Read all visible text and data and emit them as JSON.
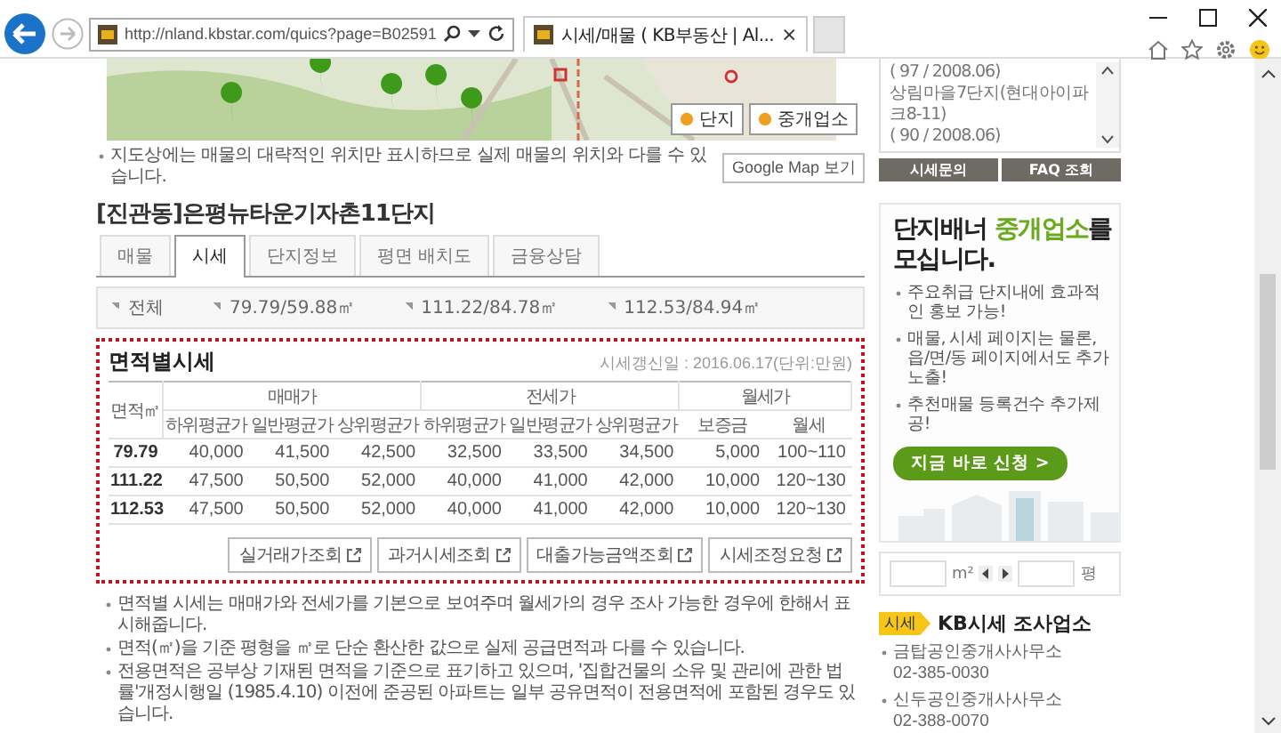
{
  "browser": {
    "url": "http://nland.kbstar.com/quics?page=B02591",
    "tab_title": "시세/매물 ( KB부동산 | Al...",
    "tab_close": "×"
  },
  "map": {
    "buttons": [
      {
        "label": "단지"
      },
      {
        "label": "중개업소"
      }
    ]
  },
  "map_notice": "지도상에는 매물의 대략적인 위치만 표시하므로 실제 매물의 위치와 다를 수 있습니다.",
  "map_button": "Google Map 보기",
  "complex_title": "[진관동]은평뉴타운기자촌11단지",
  "tabs": [
    {
      "label": "매물",
      "selected": false
    },
    {
      "label": "시세",
      "selected": true
    },
    {
      "label": "단지정보",
      "selected": false
    },
    {
      "label": "평면 배치도",
      "selected": false
    },
    {
      "label": "금융상담",
      "selected": false
    }
  ],
  "area_filters": [
    {
      "label": "전체"
    },
    {
      "label": "79.79/59.88㎡"
    },
    {
      "label": "111.22/84.78㎡"
    },
    {
      "label": "112.53/84.94㎡"
    }
  ],
  "price_table": {
    "title": "면적별시세",
    "update_note": "시세갱신일 : 2016.06.17(단위:만원)",
    "area_header": "면적㎡",
    "groups": [
      {
        "label": "매매가",
        "columns": [
          "하위평균가",
          "일반평균가",
          "상위평균가"
        ]
      },
      {
        "label": "전세가",
        "columns": [
          "하위평균가",
          "일반평균가",
          "상위평균가"
        ]
      },
      {
        "label": "월세가",
        "columns": [
          "보증금",
          "월세"
        ]
      }
    ],
    "rows": [
      [
        "79.79",
        "40,000",
        "41,500",
        "42,500",
        "32,500",
        "33,500",
        "34,500",
        "5,000",
        "100~110"
      ],
      [
        "111.22",
        "47,500",
        "50,500",
        "52,000",
        "40,000",
        "41,000",
        "42,000",
        "10,000",
        "120~130"
      ],
      [
        "112.53",
        "47,500",
        "50,500",
        "52,000",
        "40,000",
        "41,000",
        "42,000",
        "10,000",
        "120~130"
      ]
    ],
    "buttons": [
      "실거래가조회",
      "과거시세조회",
      "대출가능금액조회",
      "시세조정요청"
    ]
  },
  "notes": [
    "면적별 시세는 매매가와 전세가를 기본으로 보여주며 월세가의 경우 조사 가능한 경우에 한해서 표시해줍니다.",
    "면적(㎡)을 기준 평형을 ㎡로 단순 환산한 값으로 실제 공급면적과 다를 수 있습니다.",
    "전용면적은 공부상 기재된 면적을 기준으로 표기하고 있으며, '집합건물의 소유 및 관리에 관한 법률'개정시행일 (1985.4.10) 이전에 준공된 아파트는 일부 공유면적이 전용면적에 포함된 경우도 있습니다."
  ],
  "sidebar": {
    "recent": [
      "( 97 / 2008.06)",
      "상림마을7단지(현대아이파크8-11)",
      "( 90 / 2008.06)"
    ],
    "buttons": [
      "시세문의",
      "FAQ 조회"
    ],
    "banner": {
      "headline": [
        {
          "text": "단지배너 ",
          "accent": false
        },
        {
          "text": "중개업소",
          "accent": true
        },
        {
          "text": "를",
          "accent": false
        }
      ],
      "headline_2": "모십니다.",
      "bullets": [
        "주요취급 단지내에 효과적인 홍보 가능!",
        "매물, 시세 페이지는 물론, 읍/면/동 페이지에서도 추가 노출!",
        "추천매물 등록건수 추가제공!"
      ],
      "button": "지금 바로 신청 >"
    },
    "converter": {
      "unit_left": "m²",
      "unit_right": "평"
    },
    "agents": {
      "badge": "시세",
      "title": "KB시세 조사업소",
      "items": [
        {
          "name": "금탑공인중개사사무소",
          "phone": "02-385-0030"
        },
        {
          "name": "신두공인중개사사무소",
          "phone": "02-388-0070"
        }
      ]
    }
  }
}
